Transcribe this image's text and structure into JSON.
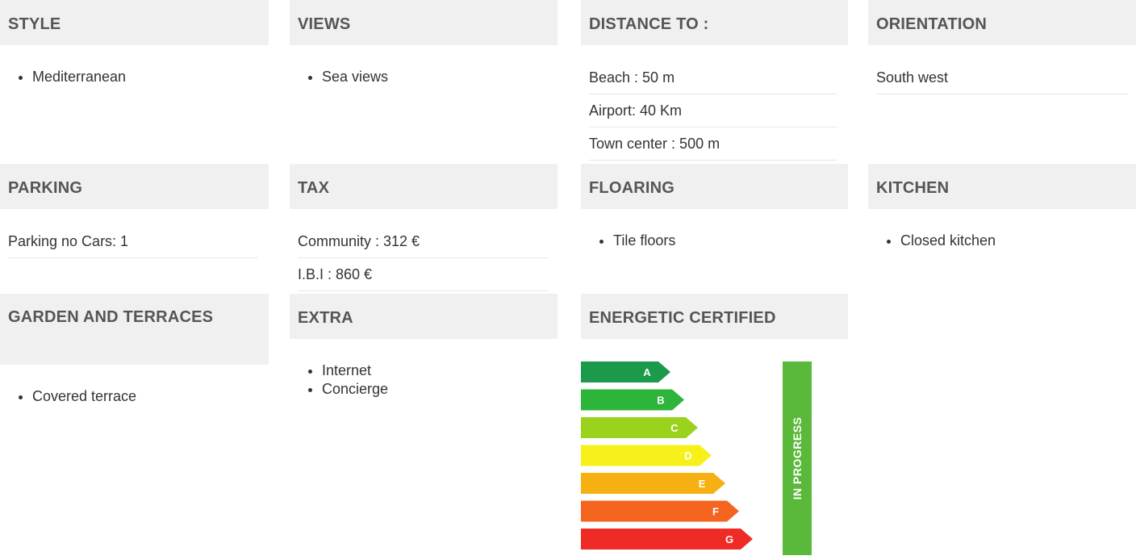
{
  "style": {
    "title": "STYLE",
    "items": [
      "Mediterranean"
    ]
  },
  "views": {
    "title": "VIEWS",
    "items": [
      "Sea views"
    ]
  },
  "distance": {
    "title": "DISTANCE TO :",
    "rows": [
      "Beach : 50 m",
      "Airport: 40 Km",
      "Town center : 500 m"
    ]
  },
  "orientation": {
    "title": "ORIENTATION",
    "rows": [
      "South west"
    ]
  },
  "parking": {
    "title": "PARKING",
    "rows": [
      "Parking no Cars: 1"
    ]
  },
  "tax": {
    "title": "TAX",
    "rows": [
      "Community : 312 €",
      "I.B.I : 860 €"
    ]
  },
  "flooring": {
    "title": "FLOARING",
    "items": [
      "Tile floors"
    ]
  },
  "kitchen": {
    "title": "KITCHEN",
    "items": [
      "Closed kitchen"
    ]
  },
  "garden": {
    "title": "GARDEN AND TERRACES",
    "items": [
      "Covered terrace"
    ]
  },
  "extra": {
    "title": "EXTRA",
    "items": [
      "Internet",
      "Concierge"
    ]
  },
  "energy": {
    "title": "ENERGETIC CERTIFIED",
    "status": "IN PROGRESS",
    "status_color": "#5ab83a",
    "classes": [
      {
        "label": "A",
        "color": "#1a9a4a"
      },
      {
        "label": "B",
        "color": "#2db53a"
      },
      {
        "label": "C",
        "color": "#9bd21c"
      },
      {
        "label": "D",
        "color": "#f7f01a"
      },
      {
        "label": "E",
        "color": "#f7b012"
      },
      {
        "label": "F",
        "color": "#f5641e"
      },
      {
        "label": "G",
        "color": "#ef2b26"
      }
    ]
  }
}
